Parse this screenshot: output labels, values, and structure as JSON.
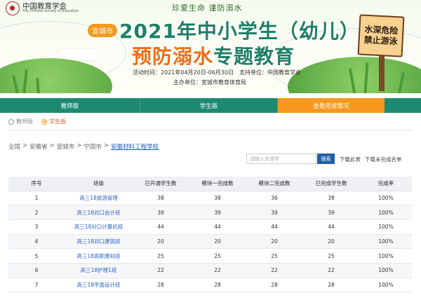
{
  "header": {
    "logo_cn": "中国教育学会",
    "logo_en": "The Chinese Society of Education",
    "slogan": "珍爱生命  谨防溺水",
    "city_tag": "宣城市",
    "title_line1": "2021年中小学生（幼儿）",
    "title_line2_highlight": "预防溺水",
    "title_line2_rest": "专题教育",
    "activity_time": "活动时间：2021年04月20日-06月30日",
    "support_unit": "支持单位：中国教育学会",
    "host_unit": "主办单位：宣城市教育体育局",
    "sign_line1": "水深危险",
    "sign_line2": "禁止游泳"
  },
  "nav": {
    "items": [
      {
        "label": "教师版",
        "active": false
      },
      {
        "label": "学生版",
        "active": false
      },
      {
        "label": "查看完成情况",
        "active": true
      }
    ]
  },
  "filter": {
    "options": [
      {
        "label": "教师版",
        "checked": false
      },
      {
        "label": "学生版",
        "checked": true
      }
    ]
  },
  "breadcrumb": {
    "items": [
      "全国",
      "安徽省",
      "宣城市",
      "宁国市"
    ],
    "current": "安徽材料工程学校"
  },
  "search": {
    "placeholder": "请输入关键字",
    "button_label": "搜索",
    "download_this": "下载此表",
    "download_incomplete": "下载未完成名单"
  },
  "table": {
    "headers": [
      "序号",
      "班级",
      "已开通学生数",
      "模块一完成数",
      "模块二完成数",
      "已完成学生数",
      "完成率"
    ],
    "rows": [
      [
        "1",
        "高三18旅游管理",
        "38",
        "38",
        "36",
        "38",
        "100%"
      ],
      [
        "2",
        "高三18对口会计班",
        "39",
        "39",
        "39",
        "39",
        "100%"
      ],
      [
        "3",
        "高三18对口计算机班",
        "44",
        "44",
        "44",
        "44",
        "100%"
      ],
      [
        "4",
        "高三18对口建筑班",
        "20",
        "20",
        "20",
        "20",
        "100%"
      ],
      [
        "5",
        "高三18高职建材班",
        "25",
        "25",
        "25",
        "25",
        "100%"
      ],
      [
        "6",
        "高三18护理1班",
        "22",
        "22",
        "22",
        "22",
        "100%"
      ],
      [
        "7",
        "高三18平面设计班",
        "28",
        "28",
        "28",
        "28",
        "100%"
      ]
    ]
  },
  "colors": {
    "brand_green": "#1c8a70",
    "accent_orange": "#f7981d",
    "link_blue": "#2a64c8",
    "search_button": "#1f5fa8"
  }
}
